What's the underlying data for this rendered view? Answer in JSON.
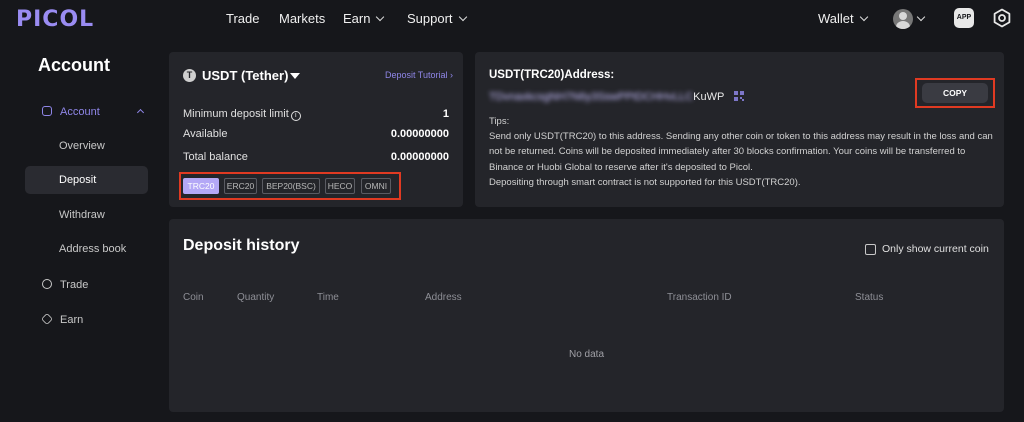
{
  "app": {
    "logo": "PICOL"
  },
  "nav": {
    "items": [
      "Trade",
      "Markets",
      "Earn",
      "Support"
    ],
    "wallet": "Wallet",
    "app_badge": "APP"
  },
  "sidebar": {
    "title": "Account",
    "items": [
      {
        "label": "Account"
      },
      {
        "label": "Overview"
      },
      {
        "label": "Deposit"
      },
      {
        "label": "Withdraw"
      },
      {
        "label": "Address book"
      },
      {
        "label": "Trade"
      },
      {
        "label": "Earn"
      }
    ]
  },
  "coin": {
    "name": "USDT (Tether)",
    "icon_glyph": "T",
    "tutorial": "Deposit Tutorial",
    "rows": [
      {
        "label": "Minimum deposit limit",
        "value": "1"
      },
      {
        "label": "Available",
        "value": "0.00000000"
      },
      {
        "label": "Total balance",
        "value": "0.00000000"
      }
    ],
    "networks": [
      "TRC20",
      "ERC20",
      "BEP20(BSC)",
      "HECO",
      "OMNI"
    ],
    "selected_network": "TRC20"
  },
  "address": {
    "title": "USDT(TRC20)Address:",
    "value_hidden": "TDvnaxkcsgNH7N6y3SswPPtDCHHvLLC",
    "value_visible": "KuWP",
    "copy": "COPY",
    "tips": [
      "Tips:",
      "Send only USDT(TRC20) to this address. Sending any other coin or token to this address may result in the loss and can not be returned. Coins will be deposited immediately after 30 blocks confirmation. Your coins will be transferred to Binance or Huobi Global to reserve after it's deposited to Picol.",
      "Depositing through smart contract is not supported for this USDT(TRC20)."
    ]
  },
  "history": {
    "title": "Deposit history",
    "only_current": "Only show current coin",
    "columns": [
      "Coin",
      "Quantity",
      "Time",
      "Address",
      "Transaction ID",
      "Status"
    ],
    "empty": "No data"
  },
  "colors": {
    "accent": "#9a8cf2",
    "highlight": "#e03a22",
    "panel": "#24252a",
    "background": "#16171b"
  }
}
